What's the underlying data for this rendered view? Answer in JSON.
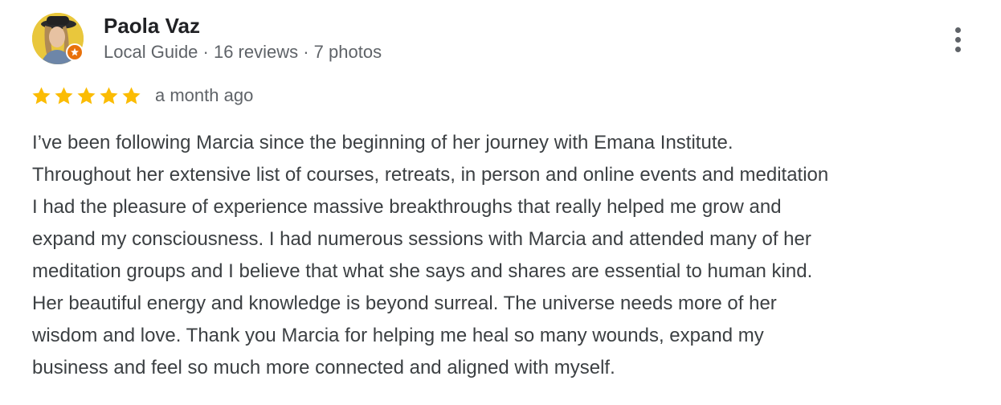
{
  "author": {
    "name": "Paola Vaz",
    "meta": "Local Guide · 16 reviews · 7 photos"
  },
  "rating": {
    "stars": 5,
    "max": 5,
    "color": "#fbbc04",
    "date": "a month ago"
  },
  "review": {
    "lines": [
      "I’ve been following Marcia since the beginning of her journey with Emana Institute.",
      "Throughout her extensive list of courses, retreats, in person and online events and meditation",
      "I had the pleasure of experience massive breakthroughs that really helped me grow and",
      "expand my consciousness. I had numerous sessions with Marcia and attended many of her",
      "meditation groups and I believe that what she says and shares are essential to human kind.",
      "Her beautiful energy and knowledge is beyond surreal. The universe needs more of her",
      "wisdom and love. Thank you Marcia for helping me heal so many wounds, expand my",
      "business and feel so much more connected and aligned with myself."
    ]
  },
  "icons": {
    "avatar": "profile-photo",
    "badge": "local-guide-badge-icon",
    "menu": "more-vert-icon",
    "star": "star-icon"
  },
  "colors": {
    "name": "#202124",
    "meta": "#5f6368",
    "body": "#3c4043",
    "badge": "#e8710a"
  }
}
